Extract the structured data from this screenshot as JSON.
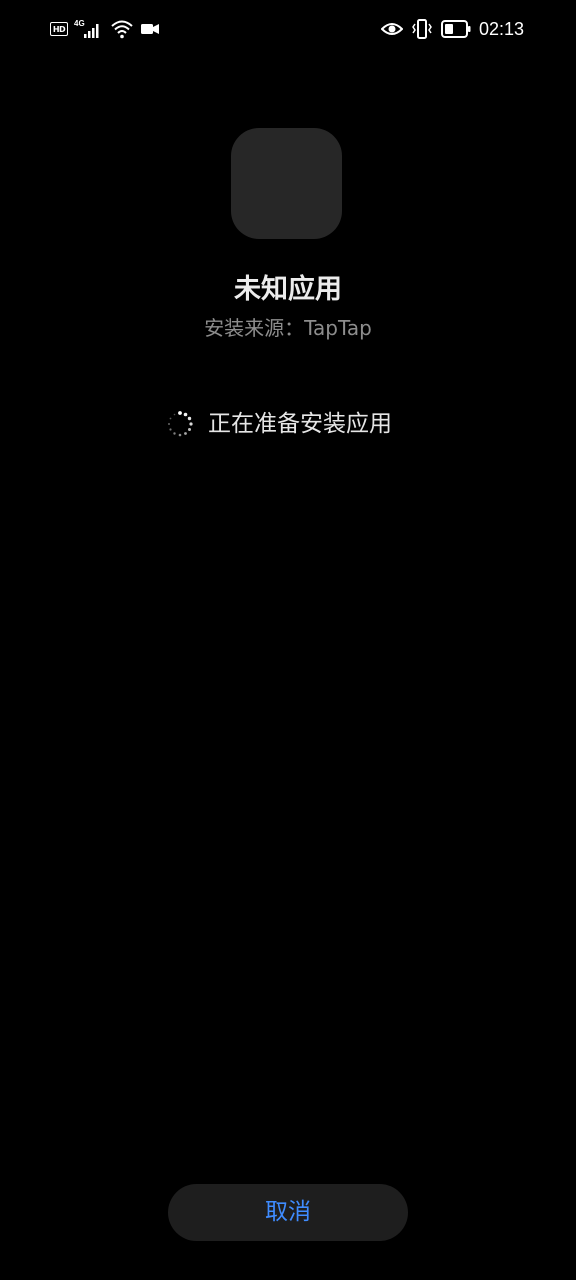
{
  "status_bar": {
    "left_icons": [
      "hd-icon",
      "4g-signal-icon",
      "wifi-icon",
      "video-camera-icon"
    ],
    "hd_label": "HD",
    "network_label": "4G",
    "right_icons": [
      "eye-icon",
      "vibrate-icon",
      "battery-icon"
    ],
    "time": "02:13"
  },
  "app": {
    "name": "未知应用",
    "source": "安装来源：TapTap"
  },
  "progress": {
    "label": "正在准备安装应用"
  },
  "actions": {
    "cancel_label": "取消"
  },
  "colors": {
    "background": "#000000",
    "accent": "#3f8cff",
    "icon_placeholder": "#272727",
    "button_bg": "#1e1e1e"
  }
}
